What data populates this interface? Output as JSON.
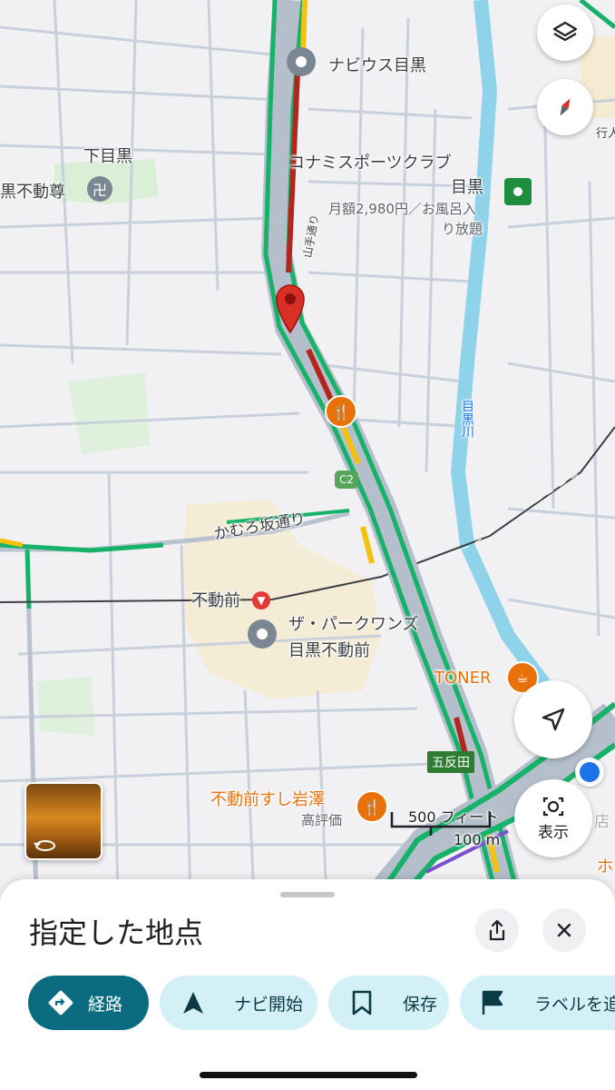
{
  "map": {
    "labels": {
      "navius": "ナビウス目黒",
      "konami": "コナミスポーツクラブ",
      "konami2": "目黒",
      "konami_price": "月額2,980円／お風呂入",
      "konami_price2": "り放題",
      "shimomeguro": "下目黒",
      "fudoson": "黒不動尊",
      "yamate": "山手通り",
      "route_c2": "C2",
      "kamurozaka": "かむろ坂通り",
      "fudomae_station": "不動前",
      "park_wunds": "ザ・パークワンズ",
      "park_wunds2": "目黒不動前",
      "toner": "TONER",
      "gotanda": "五反田",
      "sushi": "不動前すし岩澤",
      "sushi_note": "高評価",
      "meguro_river": "目黒川",
      "iwa": "ホ",
      "store_fragment": "店",
      "walk_fragment": "行人"
    },
    "scale": {
      "top": "500 フィート",
      "bottom": "100 m"
    },
    "buttons": {
      "view_label": "表示"
    }
  },
  "sheet": {
    "title": "指定した地点",
    "chips": {
      "route": "経路",
      "navi": "ナビ開始",
      "save": "保存",
      "label": "ラベルを追加"
    }
  },
  "colors": {
    "accent": "#0b6b80",
    "chip_secondary": "#d4f0f7",
    "traffic_green": "#17b26a",
    "traffic_red": "#b3261e",
    "traffic_yellow": "#f4c20d",
    "river": "#8fd3ea",
    "pin": "#d93025",
    "poi_orange": "#e8710a"
  },
  "icons": [
    "layers-icon",
    "compass-icon",
    "pin-icon",
    "restaurant-icon",
    "cafe-icon",
    "navigation-arrow-icon",
    "lens-icon",
    "street-view-icon",
    "share-icon",
    "close-icon",
    "directions-icon",
    "navi-icon",
    "bookmark-icon",
    "flag-icon"
  ]
}
